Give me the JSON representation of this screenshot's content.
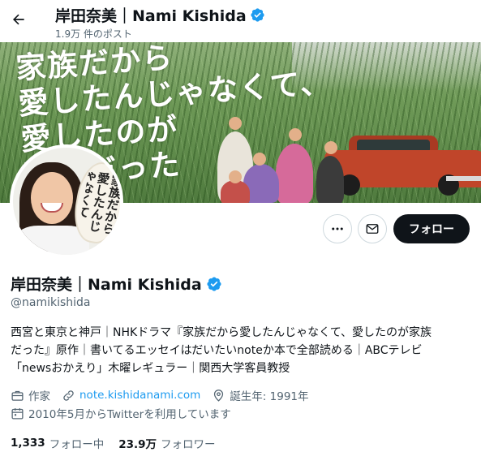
{
  "header": {
    "name": "岸田奈美｜Nami Kishida",
    "post_count": "1.9万 件のポスト"
  },
  "banner": {
    "text": "家族だから\n愛したんじゃなくて、\n愛したのが\n家族だった"
  },
  "avatar": {
    "fan_text": "家族だから愛したんじゃなくて"
  },
  "actions": {
    "follow_label": "フォロー"
  },
  "profile": {
    "name": "岸田奈美｜Nami Kishida",
    "handle": "@namikishida",
    "bio_lines": [
      "西宮と東京と神戸｜NHKドラマ『家族だから愛したんじゃなくて、愛したのが家族",
      "だった』原作｜書いてるエッセイはだいたいnoteか本で全部読める｜ABCテレビ",
      "「newsおかえり」木曜レギュラー｜関西大学客員教授"
    ],
    "occupation": "作家",
    "website": "note.kishidanami.com",
    "birthday": "誕生年: 1991年",
    "joined": "2010年5月からTwitterを利用しています"
  },
  "stats": {
    "following_count": "1,333",
    "following_label": "フォロー中",
    "followers_count": "23.9万",
    "followers_label": "フォロワー"
  },
  "colors": {
    "verified_badge": "#1d9bf0",
    "link": "#1d9bf0",
    "follow_button_bg": "#0f1419",
    "secondary_text": "#536471"
  },
  "icons": [
    "back-arrow-icon",
    "verified-badge-icon",
    "more-icon",
    "mail-icon",
    "briefcase-icon",
    "link-icon",
    "location-icon",
    "calendar-icon"
  ]
}
